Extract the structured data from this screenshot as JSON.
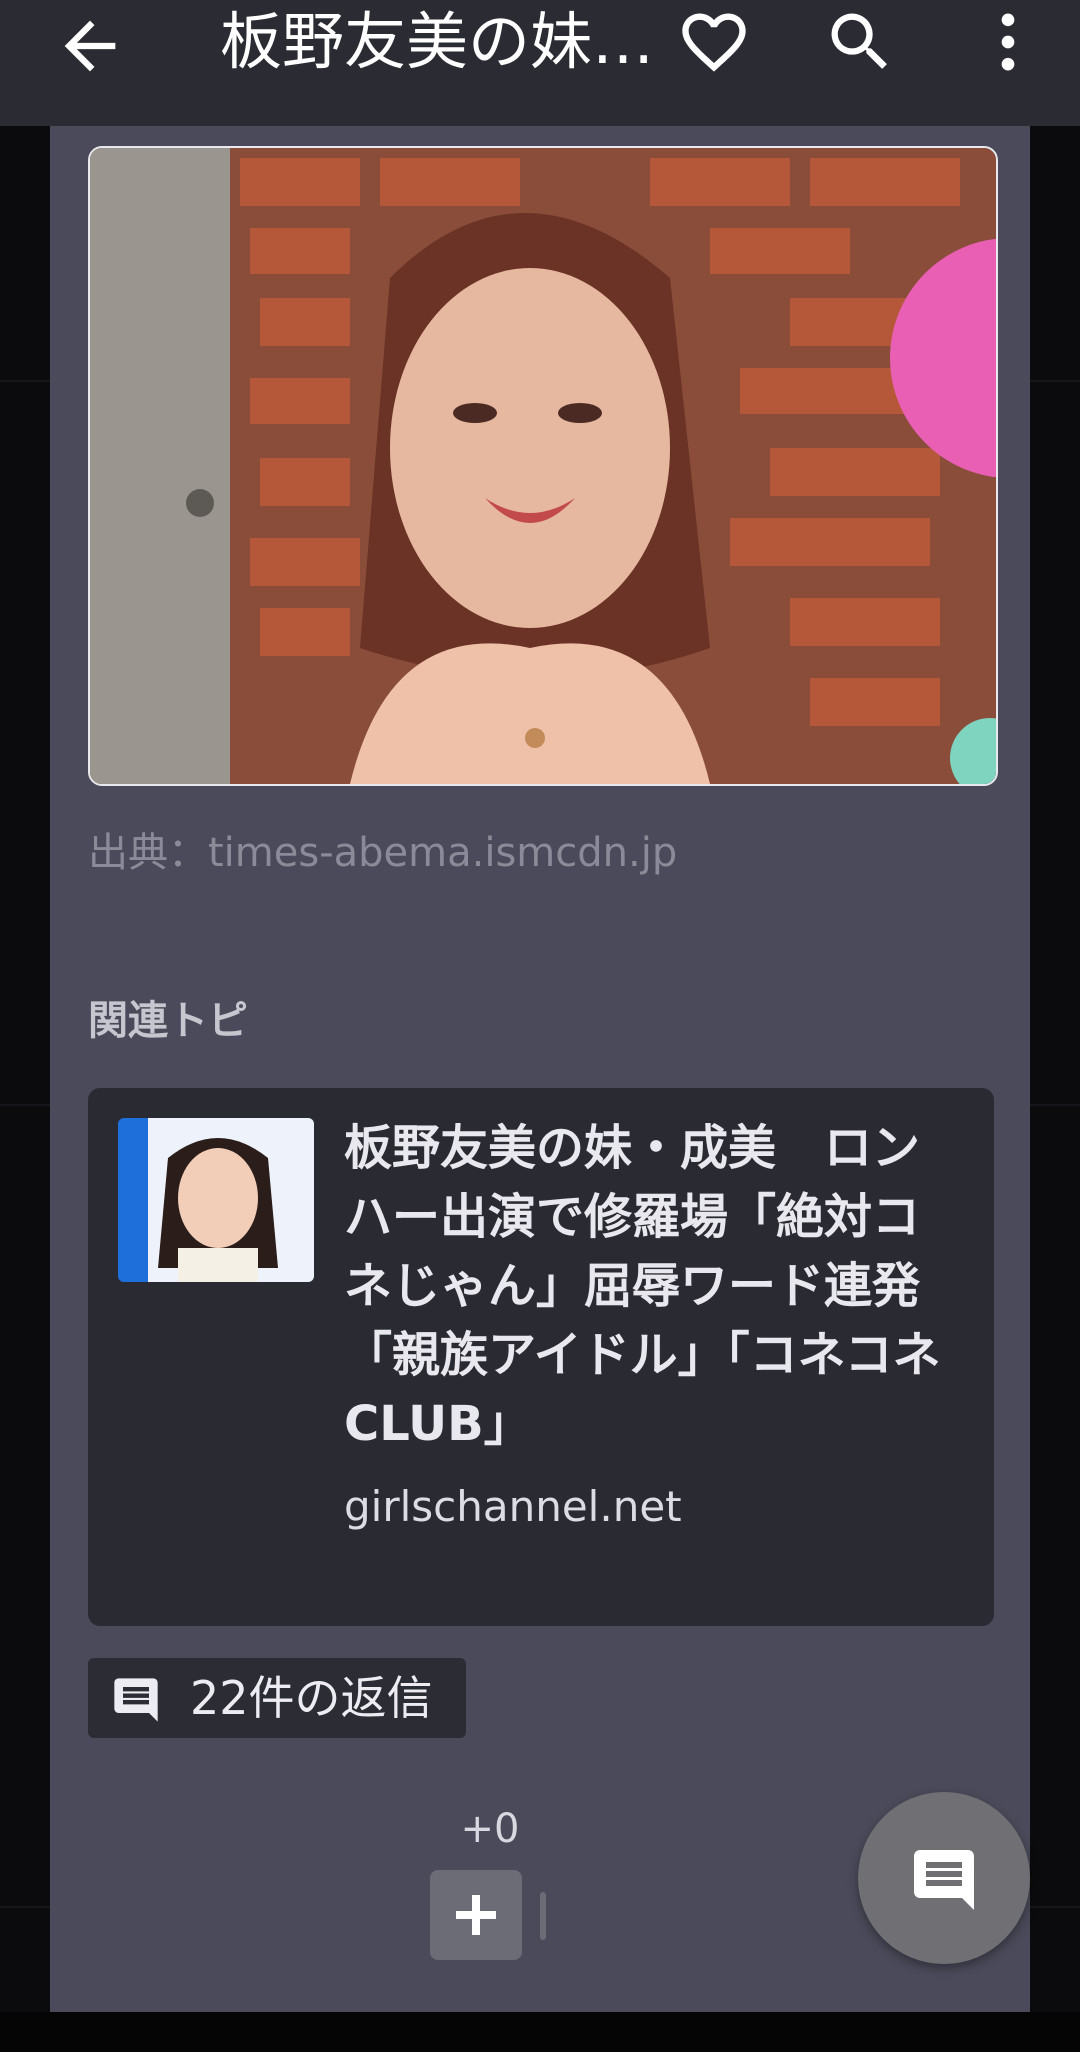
{
  "appbar": {
    "title": "板野友美の妹…",
    "back_icon": "arrow-left-icon",
    "favorite_icon": "heart-outline-icon",
    "search_icon": "search-icon",
    "more_icon": "more-vertical-icon"
  },
  "article": {
    "image_alt": "photo of a woman in front of a brick wall",
    "source_text": "出典：times-abema.ismcdn.jp"
  },
  "related": {
    "heading": "関連トピ",
    "card": {
      "title": "板野友美の妹・成美　ロンハー出演で修羅場「絶対コネじゃん」屈辱ワード連発「親族アイドル」「コネコネCLUB」",
      "domain": "girlschannel.net"
    }
  },
  "replies": {
    "label": "22件の返信",
    "icon": "comment-icon"
  },
  "vote": {
    "count": "+0",
    "plus_icon": "plus-icon"
  },
  "fab": {
    "icon": "comment-fab-icon"
  },
  "colors": {
    "appbar": "#2b2c33",
    "panel": "#4a4a5a",
    "card": "#2a2a32"
  }
}
